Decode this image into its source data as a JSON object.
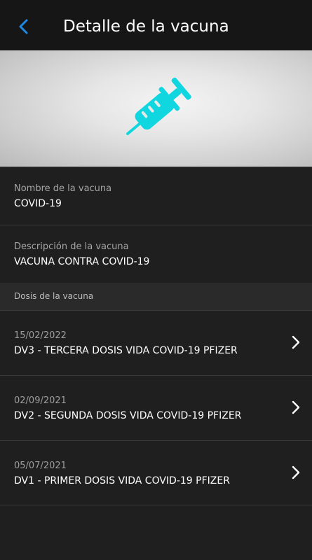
{
  "header": {
    "title": "Detalle de la vacuna",
    "back_icon": "chevron-left-icon",
    "accent": "#1e88e5"
  },
  "hero": {
    "icon": "syringe-icon",
    "icon_color": "#10d6e0"
  },
  "vaccine": {
    "name_label": "Nombre de la vacuna",
    "name_value": "COVID-19",
    "description_label": "Descripción de la vacuna",
    "description_value": "VACUNA CONTRA COVID-19"
  },
  "doses": {
    "section_title": "Dosis de la vacuna",
    "items": [
      {
        "date": "15/02/2022",
        "name": "DV3 - TERCERA DOSIS VIDA COVID-19 PFIZER"
      },
      {
        "date": "02/09/2021",
        "name": "DV2 - SEGUNDA DOSIS VIDA COVID-19 PFIZER"
      },
      {
        "date": "05/07/2021",
        "name": "DV1 - PRIMER DOSIS VIDA COVID-19 PFIZER"
      }
    ]
  }
}
